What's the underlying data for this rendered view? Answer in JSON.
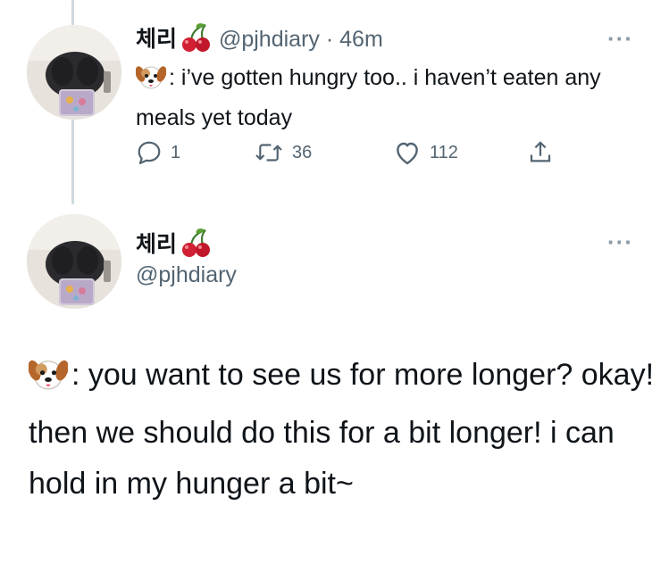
{
  "tweet1": {
    "display_name": "체리",
    "name_emoji": "cherries",
    "handle": "@pjhdiary",
    "separator": "·",
    "time": "46m",
    "text_prefix_emoji": "dog-face",
    "text": ": i’ve gotten hungry too.. i haven’t eaten any meals yet today",
    "actions": {
      "reply_count": "1",
      "retweet_count": "36",
      "like_count": "112"
    }
  },
  "tweet2": {
    "display_name": "체리",
    "name_emoji": "cherries",
    "handle": "@pjhdiary",
    "text_prefix_emoji": "dog-face",
    "text": ": you want to see us for more longer? okay! then we should do this for a bit longer! i can hold in my hunger a bit~"
  },
  "more_label": "···",
  "colors": {
    "text_primary": "#0f1419",
    "text_secondary": "#536471",
    "thread_line": "#cfd9de"
  }
}
